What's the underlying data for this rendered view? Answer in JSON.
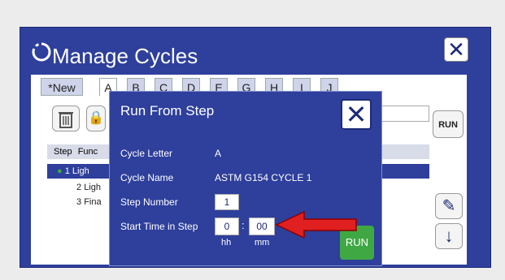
{
  "dialog": {
    "title": "Manage Cycles",
    "close_icon": "close-icon"
  },
  "tabs": [
    "*New",
    "A",
    "B",
    "C",
    "D",
    "E",
    "G",
    "H",
    "I",
    "J"
  ],
  "side": {
    "run_label": "RUN"
  },
  "list": {
    "columns": [
      "Step",
      "Func"
    ],
    "rows": [
      {
        "step": "1",
        "func": "Ligh"
      },
      {
        "step": "2",
        "func": "Ligh"
      },
      {
        "step": "3",
        "func": "Fina"
      }
    ]
  },
  "modal": {
    "title": "Run From Step",
    "fields": [
      {
        "label": "Cycle Letter",
        "value": "A"
      },
      {
        "label": "Cycle Name",
        "value": "ASTM G154 CYCLE 1"
      },
      {
        "label": "Step Number",
        "value": "1"
      },
      {
        "label": "Start Time in Step",
        "hh": "0",
        "separator": ":",
        "mm": "00"
      }
    ],
    "units": {
      "hh": "hh",
      "mm": "mm"
    },
    "run_label": "RUN"
  },
  "colors": {
    "dialog_blue": "#2e3f9c",
    "run_green": "#3fa843",
    "arrow_red": "#e02020"
  }
}
